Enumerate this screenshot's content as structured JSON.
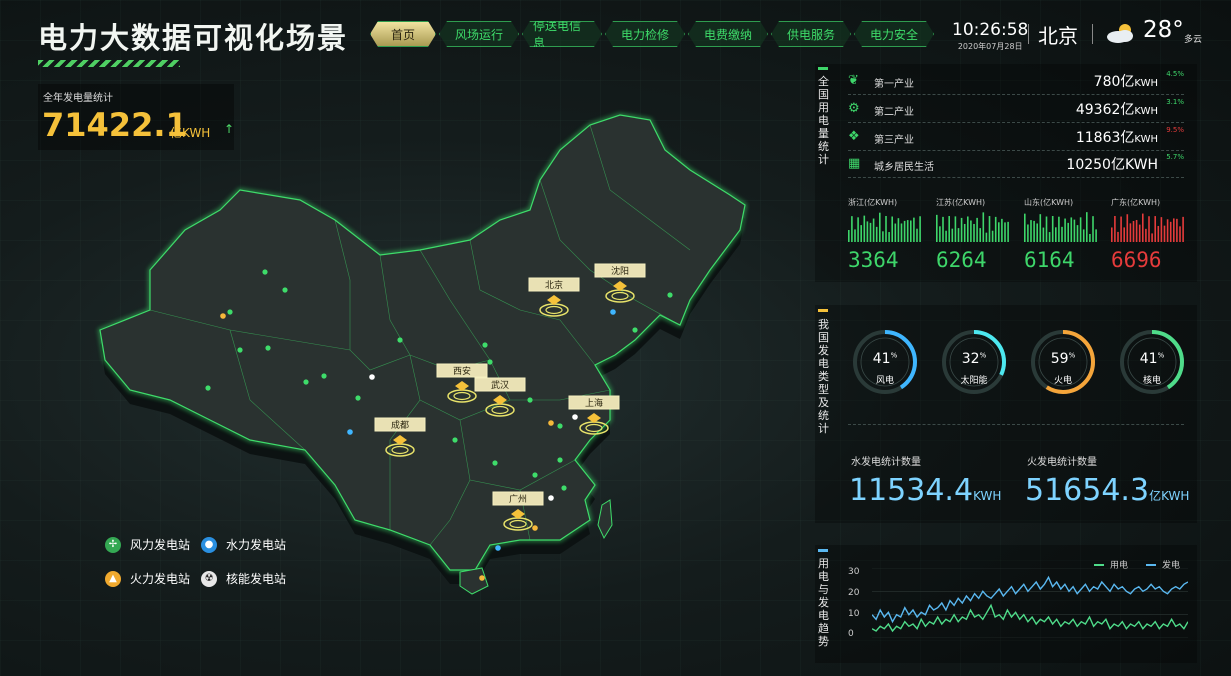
{
  "header": {
    "title": "电力大数据可视化场景",
    "nav": [
      "首页",
      "风场运行",
      "停送电信息",
      "电力检修",
      "电费缴纳",
      "供电服务",
      "电力安全"
    ],
    "time": "10:26:58",
    "date": "2020年07月28日",
    "city": "北京",
    "temperature": "28°",
    "weather": "多云"
  },
  "annual": {
    "label": "全年发电量统计",
    "value": "71422.1",
    "unit": "亿KWH",
    "arrow": "↑"
  },
  "map": {
    "cities": [
      "北京",
      "沈阳",
      "西安",
      "武汉",
      "上海",
      "成都",
      "广州"
    ]
  },
  "legend": [
    "风力发电站",
    "水力发电站",
    "火力发电站",
    "核能发电站"
  ],
  "consumption": {
    "title": "全国用电量统计",
    "rows": [
      {
        "name": "第一产业",
        "value": "780亿",
        "unit": "KWH",
        "pct": "4.5%",
        "color": "#3ed66a",
        "icon": "plant-icon"
      },
      {
        "name": "第二产业",
        "value": "49362亿",
        "unit": "KWH",
        "pct": "3.1%",
        "color": "#3ed66a",
        "icon": "gear-icon"
      },
      {
        "name": "第三产业",
        "value": "11863亿",
        "unit": "KWH",
        "pct": "9.5%",
        "color": "#e53b3b",
        "icon": "grid-icon"
      },
      {
        "name": "城乡居民生活",
        "value": "10250亿KWH",
        "unit": "",
        "pct": "5.7%",
        "color": "#3ed66a",
        "icon": "building-icon"
      }
    ],
    "provinces": [
      {
        "name": "浙江(亿KWH)",
        "value": "3364",
        "color": "#3ed66a"
      },
      {
        "name": "江苏(亿KWH)",
        "value": "6264",
        "color": "#3ed66a"
      },
      {
        "name": "山东(亿KWH)",
        "value": "6164",
        "color": "#3ed66a"
      },
      {
        "name": "广东(亿KWH)",
        "value": "6696",
        "color": "#e53b3b"
      }
    ]
  },
  "generation": {
    "title": "我国发电类型及统计",
    "rings": [
      {
        "value": "41",
        "unit": "%",
        "label": "风电",
        "pct": 0.41,
        "color": "#3fb6ff"
      },
      {
        "value": "32",
        "unit": "%",
        "label": "太阳能",
        "pct": 0.32,
        "color": "#4de8f0"
      },
      {
        "value": "59",
        "unit": "%",
        "label": "火电",
        "pct": 0.59,
        "color": "#f5a53a"
      },
      {
        "value": "41",
        "unit": "%",
        "label": "核电",
        "pct": 0.41,
        "color": "#4fdc8a"
      }
    ],
    "hydro": {
      "label": "水发电统计数量",
      "value": "11534.4",
      "unit": "KWH"
    },
    "thermal": {
      "label": "火发电统计数量",
      "value": "51654.3",
      "unit": "亿KWH"
    }
  },
  "trend": {
    "title": "用电与发电趋势",
    "series_labels": [
      "用电",
      "发电"
    ],
    "y_ticks": [
      "30",
      "20",
      "10",
      "0"
    ]
  },
  "chart_data": {
    "type": "line",
    "title": "",
    "xlabel": "",
    "ylabel": "",
    "ylim": [
      0,
      30
    ],
    "series": [
      {
        "name": "用电",
        "color": "#4fdc8a",
        "values": [
          4,
          3,
          5,
          4,
          6,
          3,
          5,
          4,
          7,
          5,
          6,
          4,
          8,
          5,
          7,
          6,
          9,
          6,
          8,
          7,
          10,
          7,
          9,
          8,
          12,
          9,
          10,
          8,
          11,
          14,
          9,
          10,
          8,
          12,
          9,
          11,
          8,
          10,
          7,
          9,
          6,
          8,
          7,
          9,
          6,
          8,
          5,
          7,
          6,
          8,
          5,
          7,
          6,
          9,
          5,
          7,
          6,
          8,
          4,
          6,
          5,
          7,
          4,
          6,
          5,
          7,
          4,
          6,
          5,
          7,
          4,
          6,
          5,
          8,
          5,
          6,
          4,
          7
        ]
      },
      {
        "name": "发电",
        "color": "#5ab8f0",
        "values": [
          10,
          8,
          12,
          9,
          11,
          7,
          10,
          9,
          13,
          10,
          12,
          9,
          11,
          10,
          14,
          12,
          13,
          15,
          12,
          16,
          14,
          17,
          15,
          18,
          16,
          19,
          17,
          20,
          18,
          17,
          19,
          21,
          18,
          20,
          22,
          19,
          21,
          23,
          20,
          22,
          24,
          21,
          23,
          26,
          22,
          24,
          21,
          23,
          20,
          22,
          19,
          21,
          23,
          20,
          22,
          21,
          24,
          22,
          20,
          23,
          21,
          22,
          20,
          19,
          21,
          22,
          20,
          21,
          23,
          21,
          22,
          20,
          19,
          21,
          22,
          21,
          23,
          24
        ]
      }
    ]
  }
}
